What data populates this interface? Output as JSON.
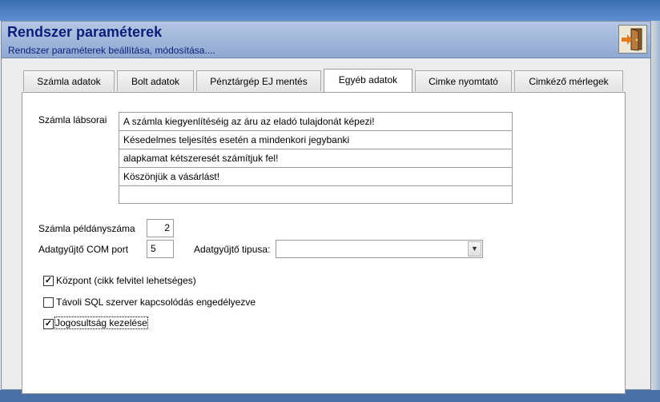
{
  "header": {
    "title": "Rendszer paraméterek",
    "subtitle": "Rendszer paraméterek beállítása, módosítása...."
  },
  "tabs": [
    {
      "label": "Számla adatok",
      "active": false
    },
    {
      "label": "Bolt adatok",
      "active": false
    },
    {
      "label": "Pénztárgép EJ mentés",
      "active": false
    },
    {
      "label": "Egyéb adatok",
      "active": true
    },
    {
      "label": "Cimke nyomtató",
      "active": false
    },
    {
      "label": "Cimkéző mérlegek",
      "active": false
    }
  ],
  "form": {
    "footer_label": "Számla lábsorai",
    "footer_lines": [
      "A számla kiegyenlítéséig az áru az eladó tulajdonát képezi!",
      "Késedelmes teljesítés esetén a mindenkori jegybanki",
      "alapkamat kétszeresét számítjuk fel!",
      "Köszönjük a vásárlást!",
      ""
    ],
    "copies_label": "Számla példányszáma",
    "copies_value": "2",
    "com_label": "Adatgyűjtő COM port",
    "com_value": "5",
    "collector_type_label": "Adatgyűjtő tipusa:",
    "collector_type_value": ""
  },
  "checkboxes": [
    {
      "label": "Központ (cikk felvitel lehetséges)",
      "checked": true
    },
    {
      "label": "Távoli SQL szerver kapcsolódás engedélyezve",
      "checked": false
    },
    {
      "label": "Jogosultság kezelése",
      "checked": true
    }
  ],
  "icons": {
    "exit": "exit-door-icon",
    "dropdown": "chevron-down-icon"
  }
}
